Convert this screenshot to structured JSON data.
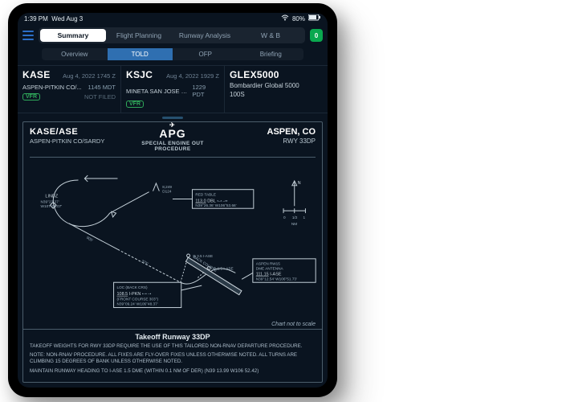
{
  "status_bar": {
    "time": "1:39 PM",
    "date": "Wed Aug 3",
    "battery": "80%"
  },
  "main_tabs": {
    "items": [
      "Summary",
      "Flight Planning",
      "Runway Analysis",
      "W & B"
    ],
    "active_index": 0
  },
  "sub_tabs": {
    "items": [
      "Overview",
      "TOLD",
      "OFP",
      "Briefing"
    ],
    "active_index": 1
  },
  "status_indicator": {
    "label": "0"
  },
  "airports": {
    "origin": {
      "icao": "KASE",
      "timestamp": "Aug 4, 2022 1745 Z",
      "name": "ASPEN-PITKIN CO/...",
      "local": "1145 MDT",
      "rules": "VFR",
      "filed": "NOT FILED"
    },
    "destination": {
      "icao": "KSJC",
      "timestamp": "Aug 4, 2022 1929 Z",
      "name": "MINETA SAN JOSE I...",
      "local": "1229 PDT",
      "rules": "VFR"
    }
  },
  "aircraft": {
    "code": "GLEX5000",
    "name": "Bombardier Global 5000",
    "variant": "100S"
  },
  "chart": {
    "pair": "KASE/ASE",
    "airport_full": "ASPEN-PITKIN CO/SARDY",
    "brand": "APG",
    "brand_sub": "SPECIAL ENGINE OUT PROCEDURE",
    "city": "ASPEN, CO",
    "runway": "RWY 33DP",
    "fixes": {
      "lindz": {
        "name": "LINDZ",
        "lat": "N39°23.37'",
        "lon": "W107°00.07'"
      },
      "redtable": {
        "name": "RED TABLE",
        "freq": "113.0",
        "id": "DBL",
        "lat": "N39°26.36'",
        "lon": "W106°53.66'"
      },
      "aspen_rwy15": {
        "name": "ASPEN RW15",
        "sub": "DME ANTENNA",
        "freq": "111.15",
        "id": "I-ASE",
        "lat": "N39°12.54'",
        "lon": "W106°51.73'"
      },
      "loc": {
        "title": "LOC (BACK CRS)",
        "freq": "108.5",
        "id": "I-PKN",
        "front": "(FRONT COURSE 303°)",
        "lat": "N39°09.24'",
        "lon": "W106°48.37'"
      }
    },
    "annot": {
      "obst": "8,249",
      "obst_id": "D124",
      "track_905": "905'",
      "track_375": "375'",
      "d35": "D 3.5 I-ASE",
      "d15": "D 1.5 I-ASE",
      "bc": "BACK COURSE",
      "north": "N",
      "scale1": "1",
      "scale2": "1/2",
      "scale_unit": "NM",
      "disclaimer": "Chart not to scale"
    }
  },
  "takeoff": {
    "title": "Takeoff Runway 33DP",
    "p1": "TAKEOFF WEIGHTS FOR RWY 33DP REQUIRE THE USE OF THIS TAILORED NON-RNAV DEPARTURE PROCEDURE.",
    "p2": "NOTE: NON-RNAV PROCEDURE. ALL FIXES ARE FLY-OVER FIXES UNLESS OTHERWISE NOTED. ALL TURNS ARE CLIMBING 15 DEGREES OF BANK UNLESS OTHERWISE NOTED.",
    "p3": "MAINTAIN RUNWAY HEADING TO I-ASE 1.5 DME (WITHIN 0.1 NM OF DER) (N39 13.99 W106 52.42)"
  }
}
